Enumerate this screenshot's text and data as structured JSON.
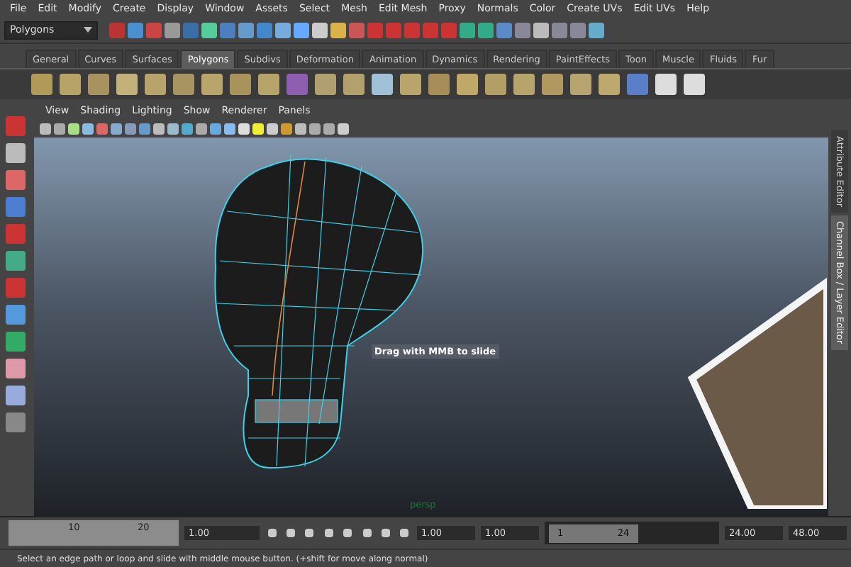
{
  "menu_bar": [
    "File",
    "Edit",
    "Modify",
    "Create",
    "Display",
    "Window",
    "Assets",
    "Select",
    "Mesh",
    "Edit Mesh",
    "Proxy",
    "Normals",
    "Color",
    "Create UVs",
    "Edit UVs",
    "Help"
  ],
  "status_line": {
    "mode": "Polygons"
  },
  "shelf": {
    "tabs": [
      {
        "label": "General",
        "selected": false
      },
      {
        "label": "Curves",
        "selected": false
      },
      {
        "label": "Surfaces",
        "selected": false
      },
      {
        "label": "Polygons",
        "selected": true
      },
      {
        "label": "Subdivs",
        "selected": false
      },
      {
        "label": "Deformation",
        "selected": false
      },
      {
        "label": "Animation",
        "selected": false
      },
      {
        "label": "Dynamics",
        "selected": false
      },
      {
        "label": "Rendering",
        "selected": false
      },
      {
        "label": "PaintEffects",
        "selected": false
      },
      {
        "label": "Toon",
        "selected": false
      },
      {
        "label": "Muscle",
        "selected": false
      },
      {
        "label": "Fluids",
        "selected": false
      },
      {
        "label": "Fur",
        "selected": false
      }
    ]
  },
  "panel_menu": [
    "View",
    "Shading",
    "Lighting",
    "Show",
    "Renderer",
    "Panels"
  ],
  "viewport": {
    "tooltip": "Drag with MMB to slide",
    "camera": "persp"
  },
  "side_tabs": [
    {
      "label": "Attribute Editor",
      "selected": false
    },
    {
      "label": "Channel Box / Layer Editor",
      "selected": true
    }
  ],
  "time_slider": {
    "ticks": [
      "10",
      "20"
    ],
    "current_time": "1.00",
    "range_start": "1.00",
    "playback_start": "1.00",
    "range_slider": {
      "level": 0.55,
      "start": "1",
      "end": "24"
    },
    "playback_end": "24.00",
    "range_end": "48.00"
  },
  "help_line": "Select an edge path or loop and slide with middle mouse button. (+shift for move along normal)"
}
